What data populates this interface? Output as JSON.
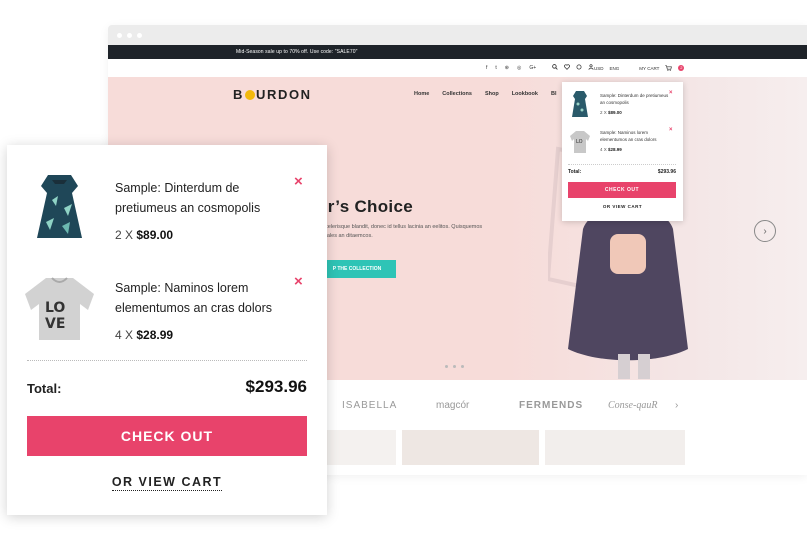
{
  "site": {
    "promo_text": "Mid-Season sale up to 70% off. Use code: \"SALE70\"",
    "social_icons": [
      "f",
      "t",
      "⊛",
      "◎",
      "G+"
    ],
    "currency": "USD",
    "language": "ENG",
    "mini_cart_label": "MY CART",
    "mini_cart_count": "2",
    "logo": {
      "pre": "B",
      "post": "URDON"
    },
    "nav": [
      "Home",
      "Collections",
      "Shop",
      "Lookbook",
      "Bl"
    ],
    "hero_title": "er’s Choice",
    "hero_text": "s scelerisque blandit, donec id tellus lacinia an eelitos. Quisquemos sodales an ditaemcos.",
    "hero_button": "P THE COLLECTION",
    "brands": [
      "ISABELLA",
      "magcór",
      "FERMENDS",
      "Conse-qauR"
    ],
    "brand_next": "›"
  },
  "mini_dropdown": {
    "items": [
      {
        "name": "Sample: Dinterdum de pretiumeus an cosmopolis",
        "qty": "2 X ",
        "price": "$89.00",
        "remove": "×"
      },
      {
        "name": "Sample: Naminos lorem elementumos an cras dolors",
        "qty": "4 X ",
        "price": "$28.99",
        "remove": "×"
      }
    ],
    "total_label": "Total:",
    "total_value": "$293.96",
    "checkout_label": "CHECK OUT",
    "view_cart_label": "OR VIEW CART"
  },
  "cart_popup": {
    "items": [
      {
        "name": "Sample: Dinterdum de pretiumeus an cosmopolis",
        "qty": "2 X ",
        "price": "$89.00",
        "remove": "×"
      },
      {
        "name": "Sample: Naminos lorem elementumos an cras dolors",
        "qty": "4 X ",
        "price": "$28.99",
        "remove": "×"
      }
    ],
    "total_label": "Total:",
    "total_value": "$293.96",
    "checkout_label": "CHECK OUT",
    "view_cart_label": "OR VIEW CART"
  },
  "colors": {
    "accent": "#e8436b",
    "teal": "#2ec4b6",
    "hero_bg": "#f7dcd9",
    "topbar": "#1e2329"
  }
}
